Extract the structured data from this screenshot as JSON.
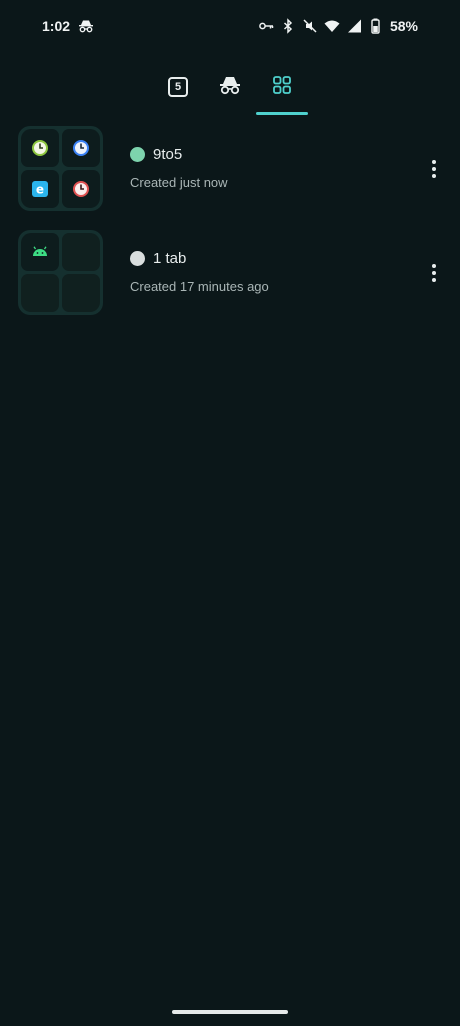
{
  "status_bar": {
    "time": "1:02",
    "battery": "58%",
    "icons": [
      "incognito-icon",
      "key-icon",
      "bluetooth-icon",
      "mute-icon",
      "wifi-icon",
      "signal-icon",
      "battery-icon"
    ]
  },
  "tab_switcher": {
    "tab_count": "5",
    "tabs": [
      "tab-count",
      "incognito",
      "tab-groups"
    ],
    "selected": "tab-groups",
    "accent": "#4fd1cd"
  },
  "groups": [
    {
      "title": "9to5",
      "subtitle": "Created just now",
      "color": "#7dd3ad",
      "favicons": [
        "clock-green-icon",
        "clock-blue-icon",
        "e-blue-icon",
        "clock-red-icon"
      ]
    },
    {
      "title": "1 tab",
      "subtitle": "Created 17 minutes ago",
      "color": "#d9dede",
      "favicons": [
        "android-icon"
      ]
    }
  ]
}
